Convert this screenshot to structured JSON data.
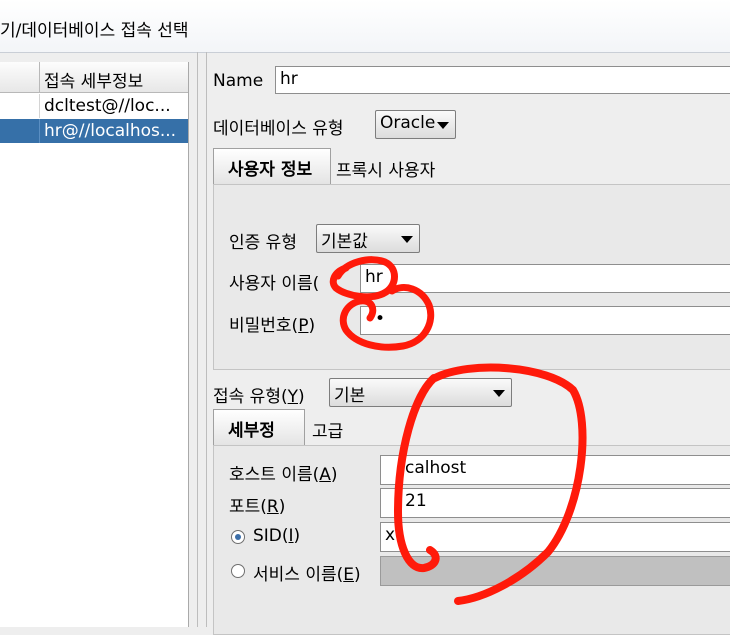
{
  "window": {
    "title": "기/데이터베이스 접속 선택"
  },
  "connections": {
    "header": "접속 세부정보",
    "rows": [
      {
        "label": "dcltest@//loc...",
        "selected": false
      },
      {
        "label": "hr@//localhos...",
        "selected": true
      }
    ]
  },
  "form": {
    "name_label": "Name",
    "name_value": "hr",
    "db_type_label": "데이터베이스 유형",
    "db_type_value": "Oracle",
    "auth_tabs": {
      "user_info": "사용자 정보",
      "proxy_user": "프록시 사용자"
    },
    "auth_type_label": "인증 유형",
    "auth_type_value": "기본값",
    "username_label": "사용자 이름(",
    "username_value": "hr",
    "password_label_a": "비밀번호(",
    "password_label_key": "P",
    "password_label_b": ")",
    "password_value": "••",
    "conn_type_label_a": "접속 유형(",
    "conn_type_label_key": "Y",
    "conn_type_label_b": ")",
    "conn_type_value": "기본",
    "detail_tabs": {
      "details": "세부정보",
      "advanced": "고급"
    },
    "host_label_a": "호스트 이름(",
    "host_label_key": "A",
    "host_label_b": ")",
    "host_value": "calhost",
    "port_label_a": "포트(",
    "port_label_key": "R",
    "port_label_b": ")",
    "port_value": "21",
    "sid_label_a": "SID(",
    "sid_label_key": "I",
    "sid_label_b": ")",
    "sid_value": "x",
    "service_label_a": "서비스 이름(",
    "service_label_key": "E",
    "service_label_b": ")"
  },
  "annotation_color": "#ff1a0a"
}
